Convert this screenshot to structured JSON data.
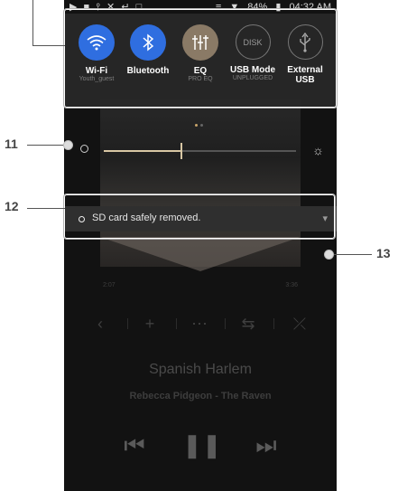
{
  "status_bar": {
    "left_icons": "▶ ■ ⫯ ✕ ↵ □",
    "battery": "84%",
    "time": "04:32 AM"
  },
  "quick_settings": {
    "tiles": [
      {
        "label": "Wi-Fi",
        "sub": "Youth_guest",
        "icon": "wifi-icon"
      },
      {
        "label": "Bluetooth",
        "sub": "",
        "icon": "bluetooth-icon"
      },
      {
        "label": "EQ",
        "sub": "PRO EQ",
        "icon": "equalizer-icon"
      },
      {
        "label": "USB Mode",
        "sub": "UNPLUGGED",
        "icon_text": "DISK"
      },
      {
        "label": "External\nUSB",
        "sub": "",
        "icon": "usb-icon"
      }
    ]
  },
  "brightness": {
    "level": 0.4
  },
  "notification": {
    "text": "SD card safely removed."
  },
  "player": {
    "elapsed": "2:07",
    "total": "3:36",
    "title": "Spanish Harlem",
    "artist": "Rebecca Pidgeon - The Raven"
  },
  "annotations": {
    "label_11": "11",
    "label_12": "12",
    "label_13": "13"
  },
  "colors": {
    "accent_blue": "#2f6ee0",
    "eq_tan": "#8a7a66",
    "slider": "#d8c7a4"
  }
}
